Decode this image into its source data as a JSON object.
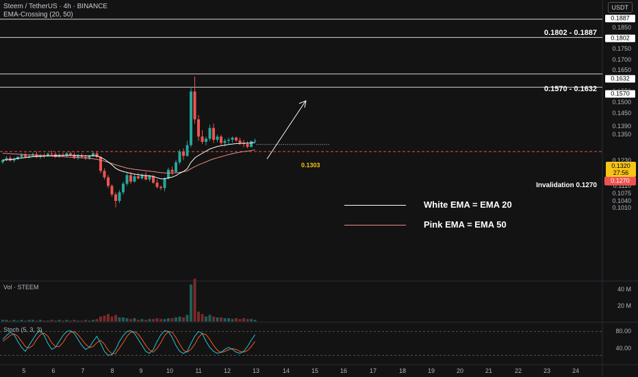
{
  "header": {
    "symbol_line": "Steem / TetherUS · 4h · BINANCE",
    "indicator_line": "EMA-Crossing (20, 50)",
    "currency": "USDT"
  },
  "price_axis": {
    "ticks": [
      "0.1850",
      "0.1750",
      "0.1700",
      "0.1650",
      "0.1600",
      "0.1550",
      "0.1500",
      "0.1450",
      "0.1390",
      "0.1350",
      "0.1230",
      "0.1190",
      "0.1150",
      "0.1110",
      "0.1075",
      "0.1040",
      "0.1010"
    ],
    "boxes": [
      "0.1887",
      "0.1802",
      "0.1632",
      "0.1570",
      "0.1270"
    ],
    "current_price": "0.1320",
    "countdown": "27:56"
  },
  "zones": {
    "upper": "0.1802 - 0.1887",
    "lower": "0.1570 - 0.1632",
    "invalidation": "Invalidation 0.1270",
    "level_label": "0.1303"
  },
  "ema_legend": {
    "white": "White EMA = EMA 20",
    "pink": "Pink EMA = EMA 50",
    "white_color": "#ffffff",
    "pink_color": "#f28b82"
  },
  "volume_pane": {
    "label": "Vol · STEEM",
    "ticks": [
      "40 M",
      "20 M"
    ]
  },
  "stoch_pane": {
    "label": "Stoch (5, 3, 3)",
    "ticks": [
      "80.00",
      "40.00"
    ]
  },
  "time_axis": {
    "labels": [
      "5",
      "6",
      "7",
      "8",
      "9",
      "10",
      "11",
      "12",
      "13",
      "14",
      "15",
      "16",
      "17",
      "18",
      "19",
      "20",
      "21",
      "22",
      "23",
      "24"
    ]
  },
  "colors": {
    "up": "#26a69a",
    "down": "#ef5350",
    "ema20": "#ffffff",
    "ema50": "#f28b82",
    "stoch_k": "#26c6da",
    "stoch_d": "#ff5722",
    "highlight": "#f5c518"
  },
  "chart_data": {
    "type": "candlestick",
    "ohlc": [
      [
        0.122,
        0.1235,
        0.1212,
        0.123
      ],
      [
        0.123,
        0.1248,
        0.1225,
        0.124
      ],
      [
        0.124,
        0.125,
        0.1222,
        0.1228
      ],
      [
        0.1228,
        0.1242,
        0.122,
        0.1235
      ],
      [
        0.1235,
        0.125,
        0.123,
        0.1245
      ],
      [
        0.1245,
        0.1262,
        0.1238,
        0.1255
      ],
      [
        0.1255,
        0.1265,
        0.124,
        0.1245
      ],
      [
        0.1245,
        0.1258,
        0.1238,
        0.125
      ],
      [
        0.125,
        0.1265,
        0.1245,
        0.1258
      ],
      [
        0.1258,
        0.127,
        0.124,
        0.1245
      ],
      [
        0.1245,
        0.126,
        0.1236,
        0.1252
      ],
      [
        0.1252,
        0.1262,
        0.124,
        0.1248
      ],
      [
        0.1248,
        0.1265,
        0.1245,
        0.126
      ],
      [
        0.126,
        0.1275,
        0.1252,
        0.1258
      ],
      [
        0.1258,
        0.1268,
        0.124,
        0.1245
      ],
      [
        0.1245,
        0.1262,
        0.1242,
        0.1255
      ],
      [
        0.1255,
        0.1265,
        0.1248,
        0.125
      ],
      [
        0.125,
        0.1268,
        0.1242,
        0.1262
      ],
      [
        0.1262,
        0.127,
        0.1248,
        0.1255
      ],
      [
        0.1255,
        0.1265,
        0.1235,
        0.124
      ],
      [
        0.124,
        0.1258,
        0.1232,
        0.125
      ],
      [
        0.125,
        0.1262,
        0.1238,
        0.1245
      ],
      [
        0.1245,
        0.1255,
        0.123,
        0.124
      ],
      [
        0.124,
        0.1255,
        0.1232,
        0.125
      ],
      [
        0.125,
        0.1268,
        0.1245,
        0.1262
      ],
      [
        0.1262,
        0.127,
        0.124,
        0.1245
      ],
      [
        0.1245,
        0.125,
        0.117,
        0.118
      ],
      [
        0.118,
        0.1192,
        0.114,
        0.115
      ],
      [
        0.115,
        0.116,
        0.11,
        0.111
      ],
      [
        0.111,
        0.1118,
        0.106,
        0.107
      ],
      [
        0.107,
        0.108,
        0.101,
        0.104
      ],
      [
        0.104,
        0.109,
        0.103,
        0.108
      ],
      [
        0.108,
        0.113,
        0.107,
        0.112
      ],
      [
        0.112,
        0.117,
        0.111,
        0.116
      ],
      [
        0.116,
        0.1175,
        0.112,
        0.113
      ],
      [
        0.113,
        0.1165,
        0.1125,
        0.1155
      ],
      [
        0.1155,
        0.117,
        0.114,
        0.1145
      ],
      [
        0.1145,
        0.1168,
        0.1138,
        0.116
      ],
      [
        0.116,
        0.1175,
        0.1135,
        0.114
      ],
      [
        0.114,
        0.116,
        0.113,
        0.1155
      ],
      [
        0.1155,
        0.1162,
        0.112,
        0.1125
      ],
      [
        0.1125,
        0.114,
        0.1098,
        0.1105
      ],
      [
        0.1105,
        0.1112,
        0.109,
        0.11
      ],
      [
        0.11,
        0.115,
        0.1085,
        0.1145
      ],
      [
        0.1145,
        0.1195,
        0.114,
        0.1185
      ],
      [
        0.1185,
        0.12,
        0.116,
        0.1175
      ],
      [
        0.1175,
        0.123,
        0.117,
        0.122
      ],
      [
        0.122,
        0.128,
        0.121,
        0.127
      ],
      [
        0.127,
        0.1285,
        0.123,
        0.125
      ],
      [
        0.125,
        0.132,
        0.1245,
        0.13
      ],
      [
        0.13,
        0.157,
        0.129,
        0.155
      ],
      [
        0.155,
        0.162,
        0.14,
        0.142
      ],
      [
        0.142,
        0.144,
        0.132,
        0.134
      ],
      [
        0.134,
        0.137,
        0.1305,
        0.1315
      ],
      [
        0.1315,
        0.134,
        0.13,
        0.133
      ],
      [
        0.133,
        0.1395,
        0.132,
        0.138
      ],
      [
        0.138,
        0.14,
        0.131,
        0.1325
      ],
      [
        0.1325,
        0.135,
        0.1315,
        0.134
      ],
      [
        0.134,
        0.1348,
        0.13,
        0.131
      ],
      [
        0.131,
        0.133,
        0.1295,
        0.132
      ],
      [
        0.132,
        0.1335,
        0.1305,
        0.1325
      ],
      [
        0.1325,
        0.134,
        0.1312,
        0.1335
      ],
      [
        0.1335,
        0.134,
        0.1315,
        0.1322
      ],
      [
        0.1322,
        0.1335,
        0.13,
        0.131
      ],
      [
        0.131,
        0.1325,
        0.129,
        0.1305
      ],
      [
        0.1305,
        0.1318,
        0.1285,
        0.1292
      ],
      [
        0.1292,
        0.1322,
        0.1288,
        0.1318
      ],
      [
        0.1318,
        0.133,
        0.131,
        0.132
      ]
    ],
    "ema20": [
      0.123,
      0.1232,
      0.1233,
      0.1235,
      0.1238,
      0.124,
      0.1242,
      0.1244,
      0.1246,
      0.1247,
      0.1248,
      0.1249,
      0.125,
      0.1251,
      0.1251,
      0.1252,
      0.1252,
      0.1253,
      0.1253,
      0.1252,
      0.1252,
      0.1251,
      0.125,
      0.125,
      0.1251,
      0.125,
      0.1243,
      0.1234,
      0.1222,
      0.1208,
      0.1192,
      0.1183,
      0.1177,
      0.1173,
      0.1168,
      0.1165,
      0.1162,
      0.116,
      0.1158,
      0.1157,
      0.1154,
      0.1148,
      0.1143,
      0.1143,
      0.1147,
      0.1151,
      0.1158,
      0.1169,
      0.1177,
      0.119,
      0.122,
      0.124,
      0.1252,
      0.1262,
      0.1272,
      0.1282,
      0.1288,
      0.1294,
      0.1297,
      0.13,
      0.1303,
      0.1305,
      0.1307,
      0.1308,
      0.1309,
      0.1309,
      0.131,
      0.1312
    ],
    "ema50": [
      0.1262,
      0.1261,
      0.126,
      0.1259,
      0.1258,
      0.1257,
      0.1256,
      0.1255,
      0.1254,
      0.1253,
      0.1252,
      0.1251,
      0.125,
      0.1249,
      0.1248,
      0.1247,
      0.1246,
      0.1245,
      0.1244,
      0.1243,
      0.1242,
      0.1241,
      0.124,
      0.1238,
      0.1236,
      0.1234,
      0.123,
      0.1225,
      0.122,
      0.1214,
      0.1208,
      0.1203,
      0.1198,
      0.1193,
      0.119,
      0.1187,
      0.1185,
      0.1183,
      0.1181,
      0.1179,
      0.1177,
      0.1174,
      0.1172,
      0.117,
      0.117,
      0.117,
      0.1171,
      0.1173,
      0.1176,
      0.118,
      0.119,
      0.12,
      0.1208,
      0.1215,
      0.1222,
      0.123,
      0.1236,
      0.1241,
      0.1246,
      0.1251,
      0.1256,
      0.126,
      0.1264,
      0.1267,
      0.127,
      0.1272,
      0.1275,
      0.1278
    ],
    "volume": [
      2,
      2,
      1,
      2,
      1,
      2,
      1,
      2,
      2,
      1,
      2,
      1,
      1,
      2,
      1,
      2,
      1,
      2,
      1,
      2,
      1,
      1,
      2,
      1,
      2,
      3,
      6,
      7,
      9,
      6,
      8,
      5,
      5,
      4,
      3,
      4,
      2,
      3,
      2,
      3,
      3,
      4,
      3,
      3,
      4,
      4,
      5,
      6,
      5,
      8,
      45,
      52,
      12,
      9,
      6,
      8,
      6,
      5,
      5,
      4,
      4,
      3,
      4,
      3,
      4,
      3,
      3,
      2
    ],
    "volume_unit": "M",
    "stoch_k": [
      60,
      70,
      78,
      72,
      55,
      40,
      30,
      45,
      60,
      75,
      82,
      70,
      50,
      35,
      40,
      55,
      70,
      80,
      82,
      75,
      60,
      45,
      35,
      40,
      55,
      68,
      50,
      30,
      20,
      22,
      35,
      55,
      70,
      80,
      82,
      75,
      60,
      45,
      30,
      25,
      35,
      55,
      72,
      82,
      80,
      65,
      45,
      30,
      25,
      30,
      50,
      68,
      80,
      75,
      55,
      40,
      30,
      25,
      28,
      35,
      40,
      35,
      28,
      25,
      30,
      42,
      58,
      72
    ],
    "stoch_d": [
      55,
      62,
      70,
      74,
      68,
      55,
      42,
      38,
      45,
      60,
      72,
      76,
      68,
      52,
      42,
      42,
      52,
      68,
      78,
      80,
      72,
      60,
      48,
      40,
      42,
      52,
      58,
      48,
      33,
      24,
      25,
      38,
      52,
      68,
      78,
      80,
      73,
      60,
      45,
      33,
      28,
      38,
      52,
      70,
      80,
      78,
      65,
      48,
      33,
      28,
      35,
      48,
      65,
      75,
      72,
      60,
      45,
      33,
      27,
      30,
      34,
      37,
      35,
      30,
      28,
      32,
      42,
      55
    ]
  }
}
